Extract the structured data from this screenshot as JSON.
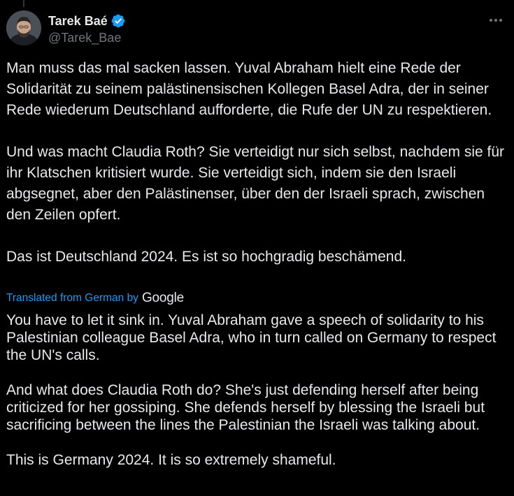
{
  "author": {
    "display_name": "Tarek Baé",
    "handle": "@Tarek_Bae",
    "verified": true,
    "verified_color": "#1d9bf0"
  },
  "menu": {
    "icon": "more-horizontal-icon"
  },
  "tweet": {
    "original_paragraphs": [
      "Man muss das mal sacken lassen. Yuval Abraham hielt eine Rede der Solidarität zu seinem palästinensischen Kollegen Basel Adra, der in seiner Rede wiederum Deutschland aufforderte, die Rufe der UN zu respektieren.",
      "Und was macht Claudia Roth? Sie verteidigt nur sich selbst, nachdem sie für ihr Klatschen kritisiert wurde. Sie verteidigt sich, indem sie den Israeli abgsegnet, aber den Palästinenser, über den der Israeli sprach, zwischen den Zeilen opfert.",
      "Das ist Deutschland 2024. Es ist so hochgradig beschämend."
    ],
    "translated_from_label": "Translated from German by",
    "translator": "Google",
    "translated_paragraphs": [
      "You have to let it sink in. Yuval Abraham gave a speech of solidarity to his Palestinian colleague Basel Adra, who in turn called on Germany to respect the UN's calls.",
      "And what does Claudia Roth do? She's just defending herself after being criticized for her gossiping. She defends herself by blessing the Israeli but sacrificing between the lines the Palestinian the Israeli was talking about.",
      "This is Germany 2024. It is so extremely shameful."
    ]
  },
  "colors": {
    "background": "#000000",
    "text": "#e7e9ea",
    "secondary_text": "#71767b",
    "accent": "#1d9bf0"
  }
}
